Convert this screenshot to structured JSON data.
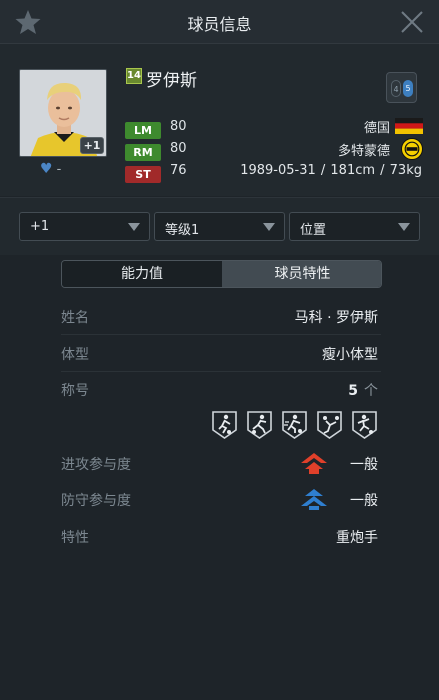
{
  "header": {
    "title": "球员信息",
    "star_icon": "star-icon",
    "close_icon": "close-icon"
  },
  "player": {
    "season_badge": "14",
    "name": "罗伊斯",
    "plus_level": "+1",
    "favorite_count": "-",
    "preferred_foot": {
      "left_label": "4",
      "right_label": "5"
    },
    "positions": [
      {
        "pos": "LM",
        "rating": "80",
        "color": "#3e8a2e"
      },
      {
        "pos": "RM",
        "rating": "80",
        "color": "#3e8a2e"
      },
      {
        "pos": "ST",
        "rating": "76",
        "color": "#a12a2a"
      }
    ],
    "nation": "德国",
    "club": "多特蒙德",
    "bio": "1989-05-31 / 181cm  / 73kg"
  },
  "filters": [
    {
      "value": "+1"
    },
    {
      "value": "等级1"
    },
    {
      "value": "位置"
    }
  ],
  "tabs": [
    {
      "label": "能力值",
      "active": false
    },
    {
      "label": "球员特性",
      "active": true
    }
  ],
  "attributes": {
    "full_name": {
      "label": "姓名",
      "value": "马科 · 罗伊斯"
    },
    "body_type": {
      "label": "体型",
      "value": "瘦小体型"
    },
    "titles": {
      "label": "称号",
      "count": "5",
      "unit": "个"
    },
    "attack": {
      "label": "进攻参与度",
      "value": "一般",
      "color": "#e0402a"
    },
    "defense": {
      "label": "防守参与度",
      "value": "一般",
      "color": "#2f7fd0"
    },
    "traits": {
      "label": "特性",
      "value": "重炮手"
    }
  },
  "trait_icons": [
    "dribble-trait-icon",
    "tackle-trait-icon",
    "speed-dribble-trait-icon",
    "volley-trait-icon",
    "finesse-shot-trait-icon"
  ]
}
